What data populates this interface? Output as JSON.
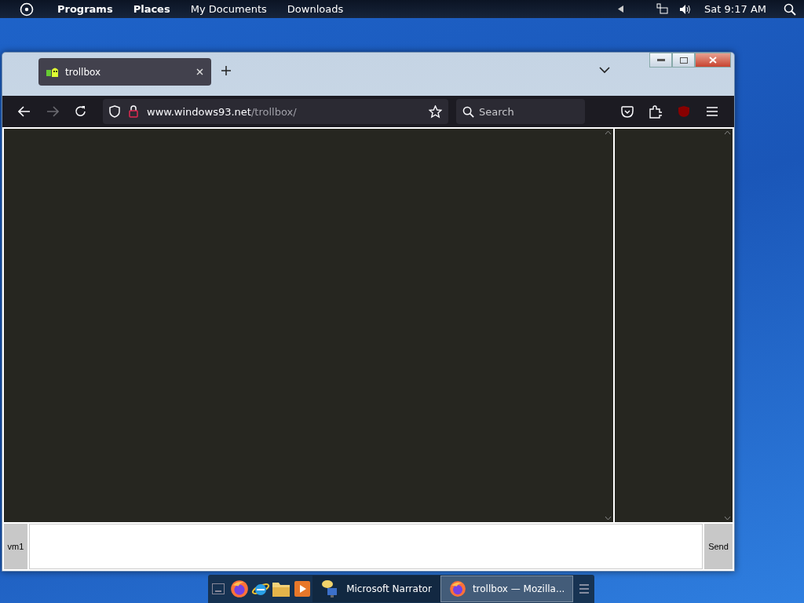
{
  "top_bar": {
    "menus": [
      "Programs",
      "Places",
      "My Documents",
      "Downloads"
    ],
    "clock": "Sat 9:17 AM"
  },
  "browser": {
    "tabs": [
      {
        "label": "trollbox",
        "selected": true
      }
    ],
    "address": {
      "domain": "www.windows93.net",
      "path": "/trollbox/"
    },
    "search": {
      "placeholder": "Search"
    },
    "chat": {
      "nick": "vm1",
      "send": "Send"
    }
  },
  "taskbar": {
    "tasks": [
      {
        "label": "Microsoft Narrator",
        "kind": "narrator",
        "selected": false
      },
      {
        "label": "trollbox — Mozilla...",
        "kind": "firefox",
        "selected": true
      }
    ]
  }
}
